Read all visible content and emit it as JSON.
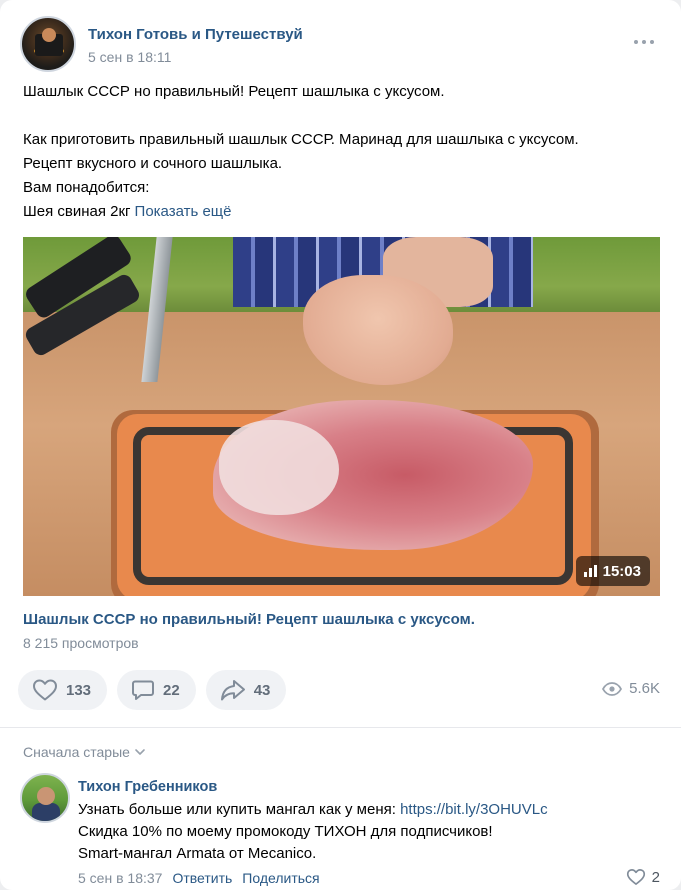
{
  "post": {
    "author": "Тихон Готовь и Путешествуй",
    "date": "5 сен в 18:11",
    "text": {
      "line1": "Шашлык СССР но правильный! Рецепт шашлыка с уксусом.",
      "line2": "Как приготовить правильный шашлык СССР. Маринад для шашлыка с уксусом.",
      "line3": "Рецепт вкусного и сочного шашлыка.",
      "line4": "Вам понадобится:",
      "line5": "Шея свиная 2кг",
      "show_more": "Показать ещё"
    }
  },
  "video": {
    "duration": "15:03",
    "title": "Шашлык СССР но правильный! Рецепт шашлыка с уксусом.",
    "views": "8 215 просмотров"
  },
  "actions": {
    "likes": "133",
    "comments": "22",
    "shares": "43",
    "views": "5.6K"
  },
  "comments": {
    "sort_label": "Сначала старые",
    "items": [
      {
        "author": "Тихон Гребенников",
        "text_before_link": "Узнать больше или купить мангал как у меня: ",
        "link": "https://bit.ly/3OHUVLc",
        "line2": "Скидка 10% по моему промокоду ТИХОН для подписчиков!",
        "line3": "Smart-мангал Armata от Mecanico.",
        "date": "5 сен в 18:37",
        "reply": "Ответить",
        "share": "Поделиться",
        "likes": "2"
      }
    ]
  },
  "colors": {
    "link": "#2a5885",
    "secondary": "#818c99",
    "button_bg": "#f0f2f5"
  }
}
